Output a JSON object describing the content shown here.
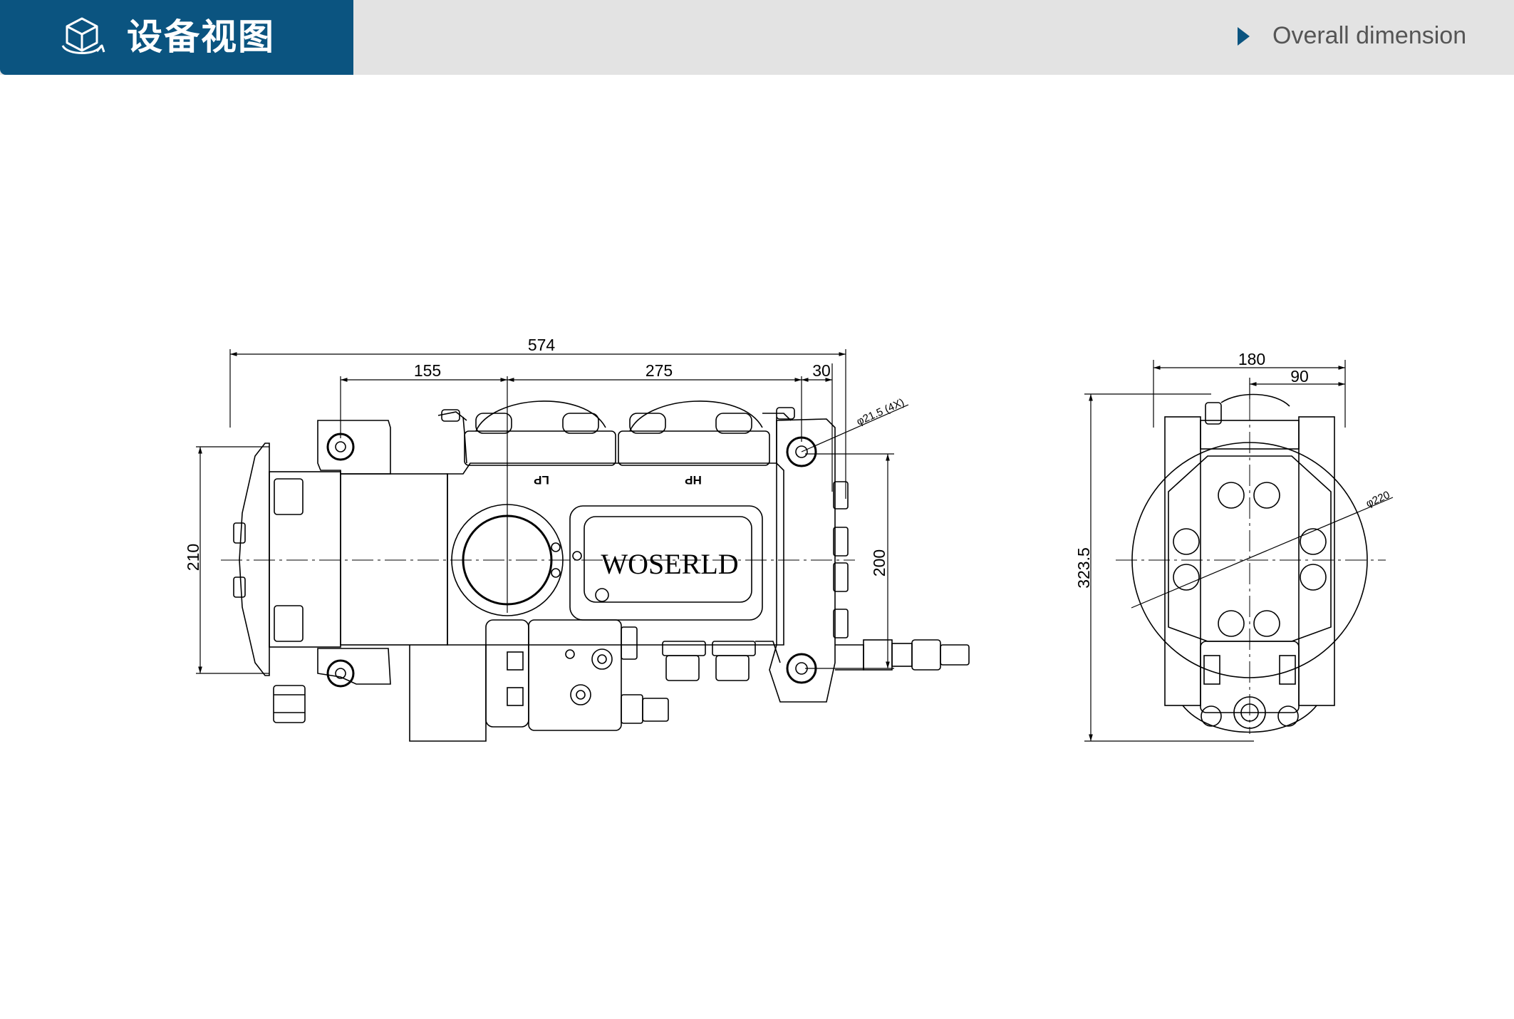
{
  "header": {
    "title": "设备视图",
    "nav_label": "Overall dimension",
    "icons": {
      "title": "cube-rotate-icon",
      "nav": "play-triangle-icon"
    },
    "colors": {
      "accent": "#0b5480",
      "bar": "#e3e3e3"
    }
  },
  "side_view": {
    "dimensions": {
      "overall_length": "574",
      "offset_155": "155",
      "offset_275": "275",
      "offset_30": "30",
      "height_210": "210",
      "height_200": "200",
      "hole_callout": "φ21.5 (4X)"
    },
    "brand": "WOSERLD",
    "port_lp": "LP",
    "port_hp": "HP"
  },
  "front_view": {
    "dimensions": {
      "width_180": "180",
      "width_90": "90",
      "height_323": "323.5",
      "diameter_220": "φ220"
    }
  }
}
